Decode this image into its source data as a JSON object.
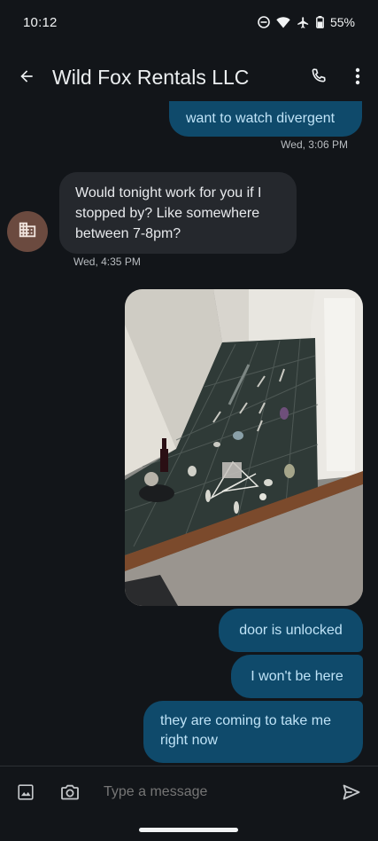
{
  "status": {
    "time": "10:12",
    "battery": "55%",
    "icons": [
      "dnd-icon",
      "wifi-icon",
      "airplane-icon",
      "battery-icon"
    ]
  },
  "header": {
    "title": "Wild Fox Rentals LLC",
    "icons": [
      "back-arrow-icon",
      "phone-icon",
      "more-vert-icon"
    ]
  },
  "messages": [
    {
      "direction": "outgoing",
      "text": "want to watch divergent",
      "timestamp": "Wed, 3:06 PM"
    },
    {
      "direction": "incoming",
      "text": "Would tonight work for you if I stopped by? Like somewhere between 7-8pm?",
      "timestamp": "Wed, 4:35 PM",
      "avatar_icon": "business-icon"
    },
    {
      "direction": "outgoing",
      "type": "image"
    },
    {
      "direction": "outgoing",
      "text": "door is unlocked"
    },
    {
      "direction": "outgoing",
      "text": "I won't be here"
    },
    {
      "direction": "outgoing",
      "text": "they are coming to take me right now"
    }
  ],
  "composer": {
    "placeholder": "Type a message",
    "icons": [
      "gallery-icon",
      "camera-icon",
      "send-icon"
    ]
  },
  "colors": {
    "background": "#121519",
    "outgoing_bubble": "#0f4a6b",
    "outgoing_text": "#bfe3f7",
    "incoming_bubble": "#25282d",
    "avatar": "#6b4a3f"
  }
}
